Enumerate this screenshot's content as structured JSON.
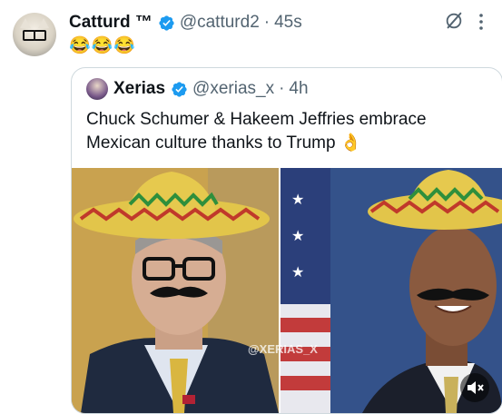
{
  "post": {
    "author_name": "Catturd ™",
    "handle": "@catturd2",
    "separator": "·",
    "time": "45s",
    "body": "😂😂😂"
  },
  "quote": {
    "author_name": "Xerias",
    "handle": "@xerias_x",
    "separator": "·",
    "time": "4h",
    "text": "Chuck Schumer & Hakeem Jeffries embrace Mexican culture thanks to Trump 👌",
    "watermark": "@XERIAS_X"
  },
  "icons": {
    "verified": "verified-badge-icon",
    "grok": "grok-icon",
    "more": "more-options-icon",
    "mute": "video-muted-icon"
  },
  "colors": {
    "verified": "#1d9bf0",
    "text": "#0f1419",
    "secondary": "#536471",
    "border": "#cfd9de"
  }
}
